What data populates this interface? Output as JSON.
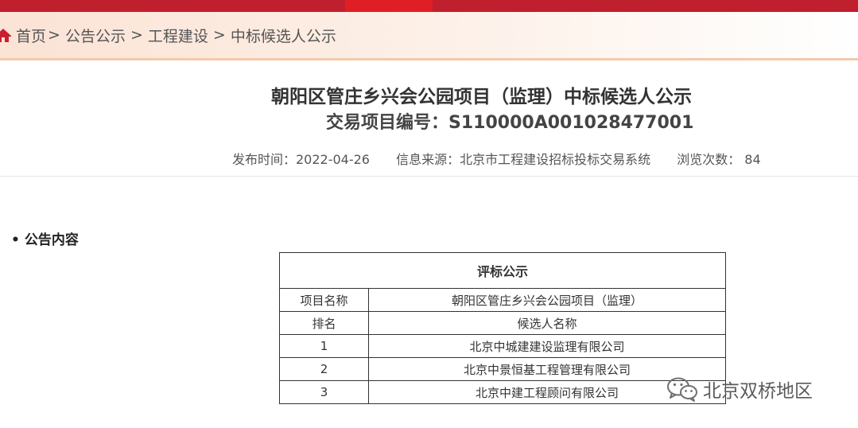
{
  "breadcrumb": {
    "items": [
      "首页",
      "公告公示",
      "工程建设",
      "中标候选人公示"
    ],
    "separator": ">"
  },
  "header": {
    "title": "朝阳区管庄乡兴会公园项目（监理）中标候选人公示",
    "code": "交易项目编号：S110000A001028477001"
  },
  "meta": {
    "publish_time": "发布时间：2022-04-26",
    "source": "信息来源：北京市工程建设招标投标交易系统",
    "views": "浏览次数：  84"
  },
  "section": {
    "title": "公告内容",
    "bullet": "•"
  },
  "table": {
    "heading": "评标公示",
    "project_label": "项目名称",
    "project_value": "朝阳区管庄乡兴会公园项目（监理）",
    "col_rank": "排名",
    "col_name": "候选人名称",
    "rows": [
      {
        "rank": "1",
        "name": "北京中城建建设监理有限公司"
      },
      {
        "rank": "2",
        "name": "北京中景恒基工程管理有限公司"
      },
      {
        "rank": "3",
        "name": "北京中建工程顾问有限公司"
      }
    ]
  },
  "watermark": {
    "text": "北京双桥地区",
    "icon": "wechat-icon"
  },
  "colors": {
    "brand_red": "#c01f2e",
    "accent_red": "#e01e25",
    "crumb_bg": "#fbe3d5"
  },
  "icons": {
    "home": "home-icon"
  }
}
